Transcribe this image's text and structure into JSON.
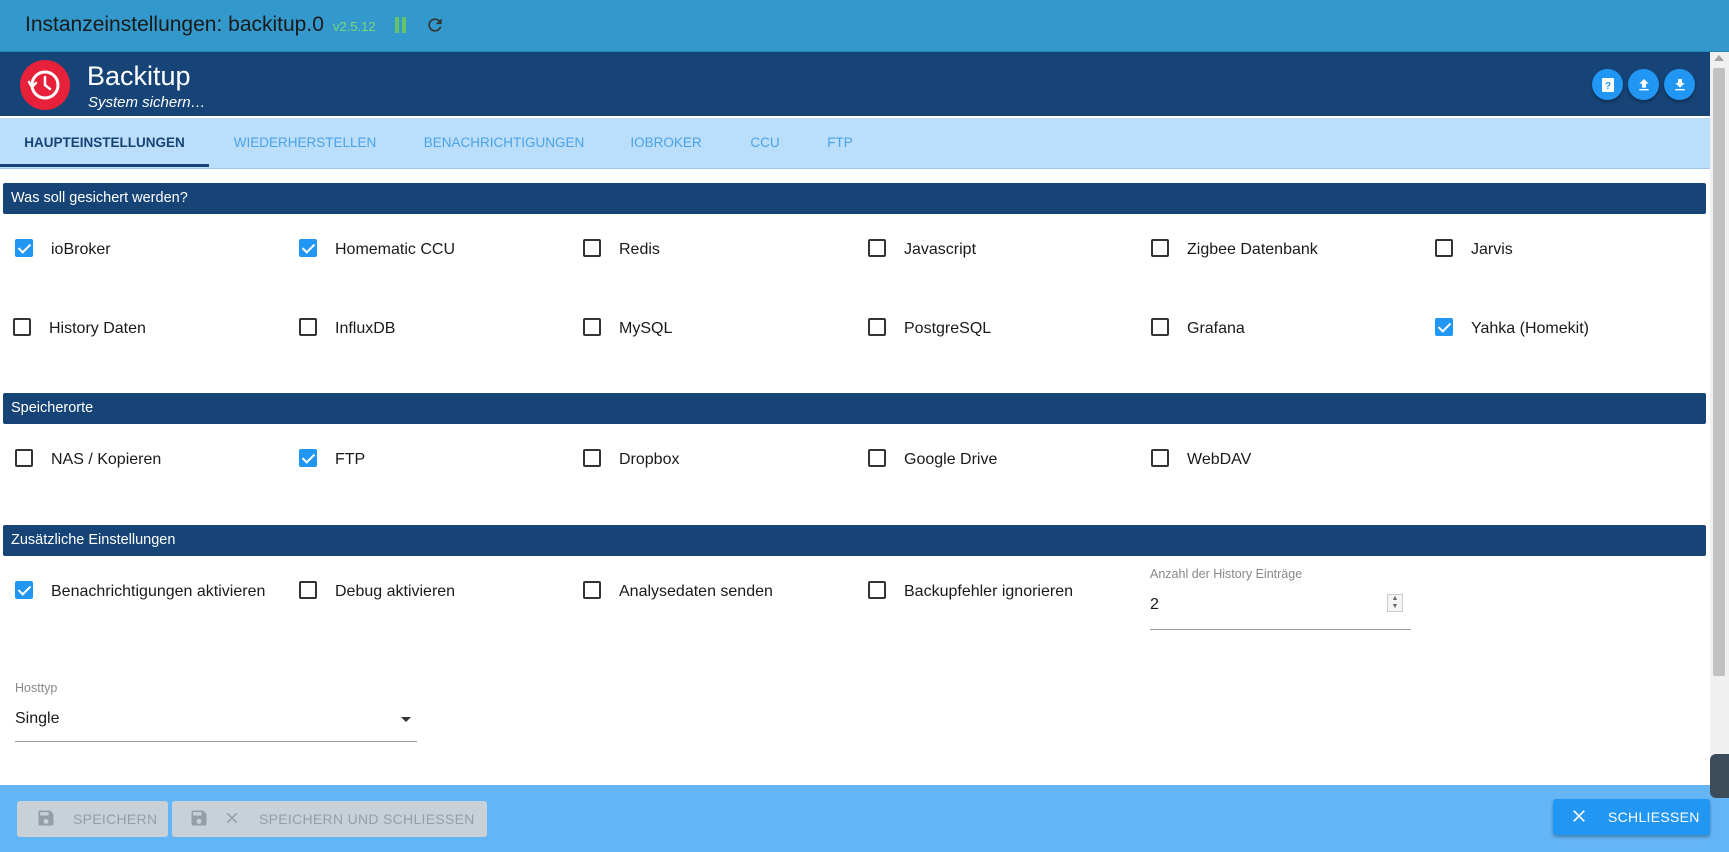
{
  "window": {
    "title": "Instanzeinstellungen: backitup.0",
    "version": "v2.5.12"
  },
  "adapter": {
    "name": "Backitup",
    "subtitle": "System sichern…"
  },
  "tabs": [
    {
      "label": "HAUPTEINSTELLUNGEN",
      "active": true
    },
    {
      "label": "WIEDERHERSTELLEN",
      "active": false
    },
    {
      "label": "BENACHRICHTIGUNGEN",
      "active": false
    },
    {
      "label": "IOBROKER",
      "active": false
    },
    {
      "label": "CCU",
      "active": false
    },
    {
      "label": "FTP",
      "active": false
    }
  ],
  "sections": {
    "backup": {
      "title": "Was soll gesichert werden?",
      "items": [
        {
          "label": "ioBroker",
          "checked": true
        },
        {
          "label": "Homematic CCU",
          "checked": true
        },
        {
          "label": "Redis",
          "checked": false
        },
        {
          "label": "Javascript",
          "checked": false
        },
        {
          "label": "Zigbee Datenbank",
          "checked": false
        },
        {
          "label": "Jarvis",
          "checked": false
        },
        {
          "label": "History Daten",
          "checked": false
        },
        {
          "label": "InfluxDB",
          "checked": false
        },
        {
          "label": "MySQL",
          "checked": false
        },
        {
          "label": "PostgreSQL",
          "checked": false
        },
        {
          "label": "Grafana",
          "checked": false
        },
        {
          "label": "Yahka (Homekit)",
          "checked": true
        }
      ]
    },
    "storage": {
      "title": "Speicherorte",
      "items": [
        {
          "label": "NAS / Kopieren",
          "checked": false
        },
        {
          "label": "FTP",
          "checked": true
        },
        {
          "label": "Dropbox",
          "checked": false
        },
        {
          "label": "Google Drive",
          "checked": false
        },
        {
          "label": "WebDAV",
          "checked": false
        }
      ]
    },
    "extra": {
      "title": "Zusätzliche Einstellungen",
      "items": [
        {
          "label": "Benachrichtigungen aktivieren",
          "checked": true
        },
        {
          "label": "Debug aktivieren",
          "checked": false
        },
        {
          "label": "Analysedaten senden",
          "checked": false
        },
        {
          "label": "Backupfehler ignorieren",
          "checked": false
        }
      ],
      "history": {
        "label": "Anzahl der History Einträge",
        "value": "2"
      },
      "hosttype": {
        "label": "Hosttyp",
        "value": "Single"
      }
    }
  },
  "footer": {
    "save": "SPEICHERN",
    "save_close": "SPEICHERN UND SCHLIESSEN",
    "close": "SCHLIESSEN"
  },
  "colors": {
    "titlebar": "#3399cc",
    "header": "#164477",
    "tabs_bg": "#bbdefb",
    "accent": "#2196f3",
    "logo": "#e8213a",
    "footer": "#64b5f6"
  }
}
